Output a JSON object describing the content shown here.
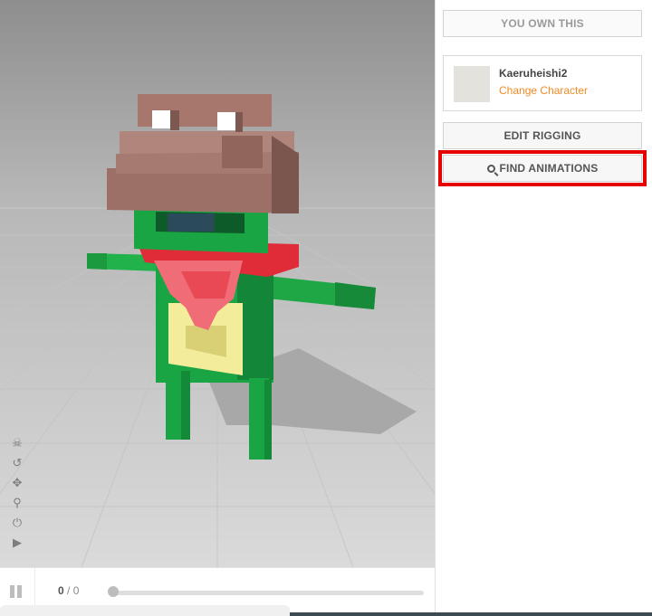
{
  "panel": {
    "own_label": "YOU OWN THIS",
    "character_name": "Kaeruheishi2",
    "change_character_label": "Change Character",
    "edit_rigging_label": "EDIT RIGGING",
    "find_animations_label": "FIND ANIMATIONS"
  },
  "timeline": {
    "current_frame": "0",
    "separator": "/",
    "total_frames": "0"
  },
  "viewport_tools": [
    "skeleton-icon",
    "reset-icon",
    "move-icon",
    "zoom-icon",
    "power-icon",
    "camera-icon"
  ],
  "colors": {
    "accent": "#f08a24",
    "highlight": "#e60000",
    "frog_green": "#18a542",
    "hat_brown": "#a97b72",
    "scarf_red": "#e8404a",
    "belly_yellow": "#f3ec9a"
  }
}
